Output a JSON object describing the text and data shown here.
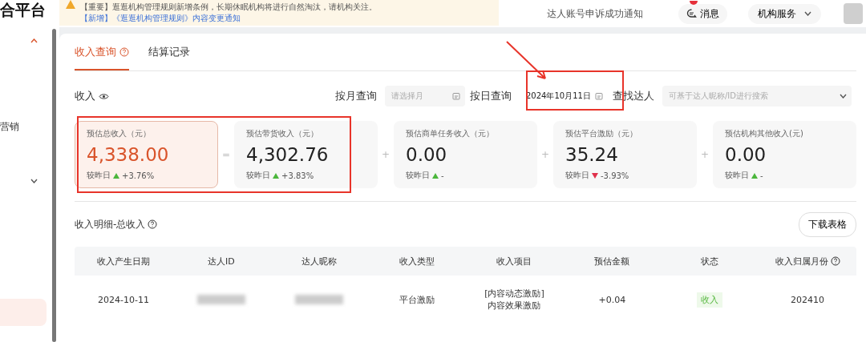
{
  "logo": "合平台",
  "banner": {
    "text": "【重要】逛逛机构管理规则新增条例，长期休眠机构将进行自然淘汰，请机构关注。",
    "link": "【新增】《逛逛机构管理规则》内容变更通知"
  },
  "header": {
    "notice": "达人账号申诉成功通知",
    "messages": "消息",
    "service_menu": "机构服务"
  },
  "sidebar": {
    "items": [
      {
        "label": "营销",
        "expanded": false
      }
    ]
  },
  "tabs": [
    {
      "label": "收入查询",
      "selected": true
    },
    {
      "label": "结算记录",
      "selected": false
    }
  ],
  "filters": {
    "title": "收入",
    "month_label": "按月查询",
    "month_placeholder": "请选择月",
    "day_label": "按日查询",
    "day_value": "2024年10月11日",
    "search_label": "查找达人",
    "search_placeholder": "可基于达人昵称/ID进行搜索"
  },
  "stats": [
    {
      "label": "预估总收入（元）",
      "value": "4,338.00",
      "compare": "较昨日",
      "rising": true,
      "change": "+3.76%",
      "selected": true
    },
    {
      "operator": "=",
      "label": "预估带货收入（元）",
      "value": "4,302.76",
      "compare": "较昨日",
      "rising": true,
      "change": "+3.83%",
      "selected": false
    },
    {
      "operator": "+",
      "label": "预估商单任务收入（元）",
      "value": "0.00",
      "compare": "较昨日",
      "rising": true,
      "change": "-",
      "selected": false
    },
    {
      "operator": "+",
      "label": "预估平台激励（元）",
      "value": "35.24",
      "compare": "较昨日",
      "rising": false,
      "change": "-3.93%",
      "selected": false
    },
    {
      "operator": "+",
      "label": "预估机构其他收入(元)",
      "value": "0.00",
      "compare": "较昨日",
      "rising": true,
      "change": "-",
      "selected": false
    }
  ],
  "detail": {
    "title": "收入明细-总收入",
    "download": "下载表格"
  },
  "table": {
    "columns": [
      "收入产生日期",
      "达人ID",
      "达人昵称",
      "收入类型",
      "收入项目",
      "预估金额",
      "状态",
      "收入归属月份"
    ],
    "rows": [
      {
        "date": "2024-10-11",
        "type": "平台激励",
        "item": "[内容动态激励] 内容效果激励",
        "amount": "+0.04",
        "status": "收入",
        "month": "202410"
      }
    ]
  }
}
